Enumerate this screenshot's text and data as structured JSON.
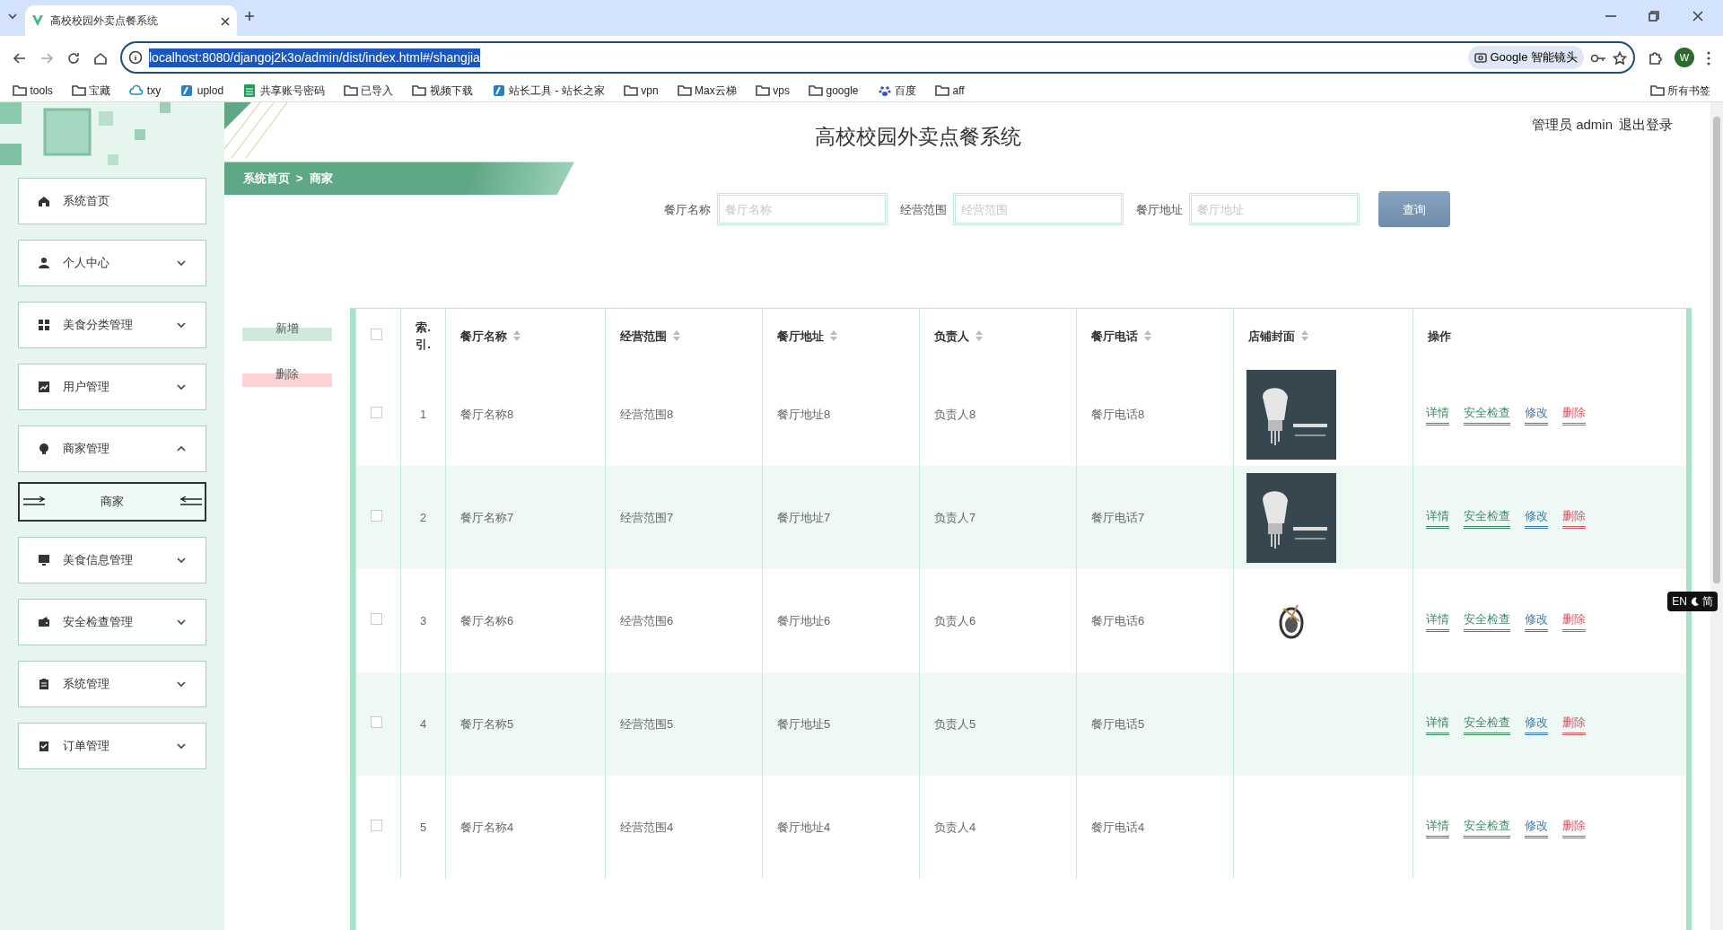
{
  "browser": {
    "tab_title": "高校校园外卖点餐系统",
    "url": "localhost:8080/djangoj2k3o/admin/dist/index.html#/shangjia",
    "url_selected": true,
    "lens_label": "Google 智能镜头",
    "profile": "W",
    "all_bookmarks": "所有书签",
    "bookmarks": [
      {
        "label": "tools",
        "kind": "folder"
      },
      {
        "label": "宝藏",
        "kind": "folder"
      },
      {
        "label": "txy",
        "kind": "cloud"
      },
      {
        "label": "uplod",
        "kind": "site"
      },
      {
        "label": "共享账号密码",
        "kind": "sheet"
      },
      {
        "label": "已导入",
        "kind": "folder"
      },
      {
        "label": "视频下载",
        "kind": "folder"
      },
      {
        "label": "站长工具 - 站长之家",
        "kind": "site"
      },
      {
        "label": "vpn",
        "kind": "folder"
      },
      {
        "label": "Max云梯",
        "kind": "folder"
      },
      {
        "label": "vps",
        "kind": "folder"
      },
      {
        "label": "google",
        "kind": "folder"
      },
      {
        "label": "百度",
        "kind": "paw"
      },
      {
        "label": "aff",
        "kind": "folder"
      }
    ]
  },
  "header": {
    "title": "高校校园外卖点餐系统",
    "user": "管理员 admin",
    "logout": "退出登录"
  },
  "breadcrumb": [
    "系统首页",
    ">",
    "商家"
  ],
  "sidebar": {
    "items": [
      {
        "label": "系统首页"
      },
      {
        "label": "个人中心",
        "expanded": false
      },
      {
        "label": "美食分类管理",
        "expanded": false
      },
      {
        "label": "用户管理",
        "expanded": false
      },
      {
        "label": "商家管理",
        "expanded": true,
        "children": [
          {
            "label": "商家",
            "selected": true
          }
        ]
      },
      {
        "label": "美食信息管理",
        "expanded": false
      },
      {
        "label": "安全检查管理",
        "expanded": false
      },
      {
        "label": "系统管理",
        "expanded": false
      },
      {
        "label": "订单管理",
        "expanded": false
      }
    ]
  },
  "search": {
    "fields": [
      {
        "label": "餐厅名称",
        "placeholder": "餐厅名称"
      },
      {
        "label": "经营范围",
        "placeholder": "经营范围"
      },
      {
        "label": "餐厅地址",
        "placeholder": "餐厅地址"
      }
    ],
    "button": "查询"
  },
  "toolbar": {
    "add": "新增",
    "delete": "删除"
  },
  "select_all_checked": false,
  "table": {
    "columns": [
      {
        "label": "索.引.",
        "sortable": false
      },
      {
        "label": "餐厅名称",
        "sortable": true
      },
      {
        "label": "经营范围",
        "sortable": true
      },
      {
        "label": "餐厅地址",
        "sortable": true
      },
      {
        "label": "负责人",
        "sortable": true
      },
      {
        "label": "餐厅电话",
        "sortable": true
      },
      {
        "label": "店铺封面",
        "sortable": true
      },
      {
        "label": "操作",
        "sortable": false
      }
    ],
    "rows": [
      {
        "checked": false,
        "cells": [
          "1",
          "餐厅名称8",
          "经营范围8",
          "餐厅地址8",
          "负责人8",
          "餐厅电话8"
        ],
        "cover": {
          "kind": "picture"
        },
        "actions": [
          {
            "label": "详情",
            "color": "#3d8a66"
          },
          {
            "label": "安全检查",
            "color": "#3d8a66"
          },
          {
            "label": "修改",
            "color": "#3b7bb5"
          },
          {
            "label": "删除",
            "color": "#cc5b66"
          }
        ]
      },
      {
        "checked": false,
        "cells": [
          "2",
          "餐厅名称7",
          "经营范围7",
          "餐厅地址7",
          "负责人7",
          "餐厅电话7"
        ],
        "cover": {
          "kind": "picture"
        },
        "actions": [
          {
            "label": "详情",
            "color": "#3d8a66"
          },
          {
            "label": "安全检查",
            "color": "#3d8a66"
          },
          {
            "label": "修改",
            "color": "#3b7bb5"
          },
          {
            "label": "删除",
            "color": "#cc5b66"
          }
        ]
      },
      {
        "checked": false,
        "cells": [
          "3",
          "餐厅名称6",
          "经营范围6",
          "餐厅地址6",
          "负责人6",
          "餐厅电话6"
        ],
        "cover": {
          "kind": "icon"
        },
        "actions": [
          {
            "label": "详情",
            "color": "#3d8a66"
          },
          {
            "label": "安全检查",
            "color": "#3d8a66"
          },
          {
            "label": "修改",
            "color": "#3b7bb5"
          },
          {
            "label": "删除",
            "color": "#cc5b66"
          }
        ]
      },
      {
        "checked": false,
        "cells": [
          "4",
          "餐厅名称5",
          "经营范围5",
          "餐厅地址5",
          "负责人5",
          "餐厅电话5"
        ],
        "actions": [
          {
            "label": "详情",
            "color": "#3d8a66"
          },
          {
            "label": "安全检查",
            "color": "#3d8a66"
          },
          {
            "label": "修改",
            "color": "#3b7bb5"
          },
          {
            "label": "删除",
            "color": "#cc5b66"
          }
        ]
      },
      {
        "checked": false,
        "cells": [
          "5",
          "餐厅名称4",
          "经营范围4",
          "餐厅地址4",
          "负责人4",
          "餐厅电话4"
        ],
        "actions": [
          {
            "label": "详情",
            "color": "#3d8a66"
          },
          {
            "label": "安全检查",
            "color": "#3d8a66"
          },
          {
            "label": "修改",
            "color": "#3b7bb5"
          },
          {
            "label": "删除",
            "color": "#cc5b66"
          }
        ]
      }
    ]
  },
  "ime": {
    "labels": [
      "EN",
      "简"
    ]
  }
}
